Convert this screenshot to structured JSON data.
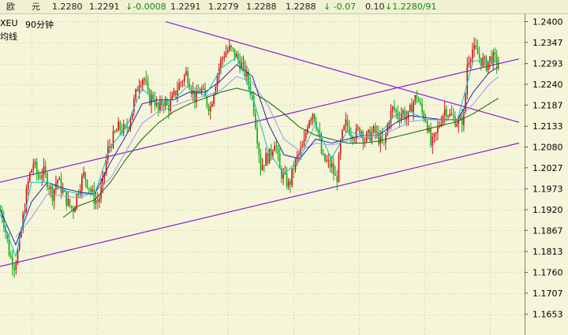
{
  "topbar": {
    "pair_label": "欧",
    "pair_label2": "元",
    "v1": "1.2280",
    "v2": "1.2291",
    "change": "↓-0.0008",
    "v3": "1.2291",
    "v4": "1.2279",
    "v5": "1.2288",
    "v6": "1.2288",
    "pct": "↓ -0.07",
    "v7": "0.10",
    "v8": "↓1.2280/91"
  },
  "legend": {
    "symbol": "XEU",
    "period": "90分钟",
    "ma_label": "均线"
  },
  "colors": {
    "background": "#f5f5da",
    "candle_up": "#cc1111",
    "candle_down": "#11aa11",
    "ma_fast": "#00c8c8",
    "ma_mid": "#2222aa",
    "ma_slow": "#116611",
    "ma_light": "#9999ee",
    "trendline": "#8822cc",
    "grid": "#c8c8a0"
  },
  "chart_data": {
    "type": "candlestick",
    "ylim": [
      1.16,
      1.2415
    ],
    "y_ticks": [
      "1.2400",
      "1.2347",
      "1.2293",
      "1.2240",
      "1.2187",
      "1.2133",
      "1.2080",
      "1.2027",
      "1.1973",
      "1.1920",
      "1.1867",
      "1.1813",
      "1.1760",
      "1.1707",
      "1.1653"
    ],
    "y_tick_values": [
      1.24,
      1.2347,
      1.2293,
      1.224,
      1.2187,
      1.2133,
      1.208,
      1.2027,
      1.1973,
      1.192,
      1.1867,
      1.1813,
      1.176,
      1.1707,
      1.1653
    ],
    "price_path": [
      [
        0,
        1.192
      ],
      [
        4,
        1.1895
      ],
      [
        8,
        1.185
      ],
      [
        12,
        1.18
      ],
      [
        18,
        1.1778
      ],
      [
        24,
        1.183
      ],
      [
        30,
        1.192
      ],
      [
        36,
        1.2
      ],
      [
        42,
        1.204
      ],
      [
        48,
        1.2
      ],
      [
        54,
        1.202
      ],
      [
        60,
        1.199
      ],
      [
        66,
        1.196
      ],
      [
        72,
        1.2
      ],
      [
        80,
        1.196
      ],
      [
        86,
        1.1935
      ],
      [
        92,
        1.192
      ],
      [
        100,
        1.198
      ],
      [
        106,
        1.201
      ],
      [
        112,
        1.198
      ],
      [
        118,
        1.195
      ],
      [
        124,
        1.194
      ],
      [
        130,
        1.199
      ],
      [
        136,
        1.207
      ],
      [
        142,
        1.21
      ],
      [
        150,
        1.213
      ],
      [
        158,
        1.212
      ],
      [
        164,
        1.215
      ],
      [
        170,
        1.22
      ],
      [
        176,
        1.225
      ],
      [
        182,
        1.226
      ],
      [
        188,
        1.22
      ],
      [
        194,
        1.221
      ],
      [
        200,
        1.217
      ],
      [
        206,
        1.22
      ],
      [
        212,
        1.218
      ],
      [
        218,
        1.22
      ],
      [
        224,
        1.223
      ],
      [
        230,
        1.225
      ],
      [
        236,
        1.227
      ],
      [
        242,
        1.223
      ],
      [
        248,
        1.22
      ],
      [
        254,
        1.223
      ],
      [
        260,
        1.22
      ],
      [
        266,
        1.218
      ],
      [
        272,
        1.224
      ],
      [
        278,
        1.229
      ],
      [
        284,
        1.232
      ],
      [
        290,
        1.233
      ],
      [
        296,
        1.232
      ],
      [
        302,
        1.23
      ],
      [
        308,
        1.228
      ],
      [
        314,
        1.225
      ],
      [
        320,
        1.22
      ],
      [
        326,
        1.21
      ],
      [
        330,
        1.203
      ],
      [
        336,
        1.205
      ],
      [
        342,
        1.206
      ],
      [
        348,
        1.21
      ],
      [
        354,
        1.202
      ],
      [
        360,
        1.2
      ],
      [
        366,
        1.198
      ],
      [
        372,
        1.203
      ],
      [
        378,
        1.206
      ],
      [
        384,
        1.208
      ],
      [
        390,
        1.215
      ],
      [
        396,
        1.217
      ],
      [
        402,
        1.213
      ],
      [
        408,
        1.205
      ],
      [
        414,
        1.204
      ],
      [
        420,
        1.203
      ],
      [
        426,
        1.199
      ],
      [
        432,
        1.21
      ],
      [
        438,
        1.214
      ],
      [
        444,
        1.212
      ],
      [
        450,
        1.211
      ],
      [
        456,
        1.213
      ],
      [
        462,
        1.21
      ],
      [
        468,
        1.211
      ],
      [
        474,
        1.212
      ],
      [
        480,
        1.21
      ],
      [
        486,
        1.208
      ],
      [
        492,
        1.215
      ],
      [
        498,
        1.218
      ],
      [
        504,
        1.216
      ],
      [
        510,
        1.217
      ],
      [
        516,
        1.215
      ],
      [
        522,
        1.219
      ],
      [
        528,
        1.221
      ],
      [
        534,
        1.217
      ],
      [
        540,
        1.215
      ],
      [
        546,
        1.208
      ],
      [
        552,
        1.211
      ],
      [
        558,
        1.215
      ],
      [
        564,
        1.218
      ],
      [
        570,
        1.216
      ],
      [
        576,
        1.215
      ],
      [
        582,
        1.214
      ],
      [
        588,
        1.216
      ],
      [
        592,
        1.23
      ],
      [
        598,
        1.233
      ],
      [
        604,
        1.232
      ],
      [
        610,
        1.23
      ],
      [
        616,
        1.229
      ],
      [
        622,
        1.231
      ],
      [
        628,
        1.23
      ],
      [
        632,
        1.229
      ]
    ],
    "ma_fast": [
      [
        0,
        1.191
      ],
      [
        20,
        1.18
      ],
      [
        40,
        1.199
      ],
      [
        60,
        1.199
      ],
      [
        80,
        1.197
      ],
      [
        100,
        1.196
      ],
      [
        120,
        1.196
      ],
      [
        140,
        1.208
      ],
      [
        160,
        1.213
      ],
      [
        180,
        1.223
      ],
      [
        200,
        1.219
      ],
      [
        220,
        1.22
      ],
      [
        240,
        1.224
      ],
      [
        260,
        1.221
      ],
      [
        280,
        1.228
      ],
      [
        300,
        1.231
      ],
      [
        320,
        1.221
      ],
      [
        340,
        1.207
      ],
      [
        360,
        1.201
      ],
      [
        380,
        1.205
      ],
      [
        400,
        1.214
      ],
      [
        420,
        1.205
      ],
      [
        440,
        1.212
      ],
      [
        460,
        1.211
      ],
      [
        480,
        1.211
      ],
      [
        500,
        1.216
      ],
      [
        520,
        1.217
      ],
      [
        540,
        1.215
      ],
      [
        560,
        1.215
      ],
      [
        580,
        1.215
      ],
      [
        600,
        1.23
      ],
      [
        620,
        1.23
      ],
      [
        632,
        1.2295
      ]
    ],
    "ma_mid": [
      [
        0,
        1.192
      ],
      [
        20,
        1.183
      ],
      [
        40,
        1.194
      ],
      [
        60,
        1.199
      ],
      [
        80,
        1.1975
      ],
      [
        100,
        1.1965
      ],
      [
        120,
        1.196
      ],
      [
        140,
        1.204
      ],
      [
        160,
        1.211
      ],
      [
        180,
        1.219
      ],
      [
        200,
        1.22
      ],
      [
        220,
        1.22
      ],
      [
        240,
        1.222
      ],
      [
        260,
        1.222
      ],
      [
        280,
        1.225
      ],
      [
        300,
        1.229
      ],
      [
        320,
        1.226
      ],
      [
        340,
        1.214
      ],
      [
        360,
        1.206
      ],
      [
        380,
        1.205
      ],
      [
        400,
        1.21
      ],
      [
        420,
        1.209
      ],
      [
        440,
        1.21
      ],
      [
        460,
        1.211
      ],
      [
        480,
        1.211
      ],
      [
        500,
        1.214
      ],
      [
        520,
        1.216
      ],
      [
        540,
        1.2155
      ],
      [
        560,
        1.215
      ],
      [
        580,
        1.215
      ],
      [
        600,
        1.222
      ],
      [
        620,
        1.227
      ],
      [
        632,
        1.2285
      ]
    ],
    "ma_slow": [
      [
        80,
        1.19
      ],
      [
        100,
        1.193
      ],
      [
        120,
        1.1945
      ],
      [
        140,
        1.199
      ],
      [
        160,
        1.205
      ],
      [
        180,
        1.21
      ],
      [
        200,
        1.214
      ],
      [
        220,
        1.217
      ],
      [
        240,
        1.219
      ],
      [
        260,
        1.2205
      ],
      [
        280,
        1.222
      ],
      [
        300,
        1.223
      ],
      [
        320,
        1.222
      ],
      [
        340,
        1.2195
      ],
      [
        360,
        1.2165
      ],
      [
        380,
        1.213
      ],
      [
        400,
        1.211
      ],
      [
        420,
        1.21
      ],
      [
        440,
        1.209
      ],
      [
        460,
        1.209
      ],
      [
        480,
        1.2095
      ],
      [
        500,
        1.2105
      ],
      [
        520,
        1.2115
      ],
      [
        540,
        1.2125
      ],
      [
        560,
        1.2135
      ],
      [
        580,
        1.2145
      ],
      [
        600,
        1.2165
      ],
      [
        620,
        1.219
      ],
      [
        632,
        1.2205
      ]
    ],
    "ma_light": [
      [
        20,
        1.185
      ],
      [
        40,
        1.19
      ],
      [
        60,
        1.196
      ],
      [
        80,
        1.1955
      ],
      [
        100,
        1.195
      ],
      [
        120,
        1.1965
      ],
      [
        140,
        1.2
      ],
      [
        160,
        1.207
      ],
      [
        180,
        1.214
      ],
      [
        200,
        1.217
      ],
      [
        220,
        1.2185
      ],
      [
        240,
        1.22
      ],
      [
        260,
        1.221
      ],
      [
        280,
        1.2225
      ],
      [
        300,
        1.226
      ],
      [
        320,
        1.2245
      ],
      [
        340,
        1.2185
      ],
      [
        360,
        1.21
      ],
      [
        380,
        1.207
      ],
      [
        400,
        1.209
      ],
      [
        420,
        1.2085
      ],
      [
        440,
        1.2095
      ],
      [
        460,
        1.2105
      ],
      [
        480,
        1.2105
      ],
      [
        500,
        1.2125
      ],
      [
        520,
        1.2145
      ],
      [
        540,
        1.215
      ],
      [
        560,
        1.215
      ],
      [
        580,
        1.215
      ],
      [
        600,
        1.219
      ],
      [
        620,
        1.224
      ],
      [
        632,
        1.226
      ]
    ],
    "trendlines": [
      {
        "x1": 210,
        "y1": 1.24,
        "x2": 658,
        "y2": 1.2143
      },
      {
        "x1": 0,
        "y1": 1.199,
        "x2": 658,
        "y2": 1.2305
      },
      {
        "x1": 0,
        "y1": 1.1775,
        "x2": 658,
        "y2": 1.209
      }
    ],
    "x_domain": [
      0,
      665
    ]
  }
}
